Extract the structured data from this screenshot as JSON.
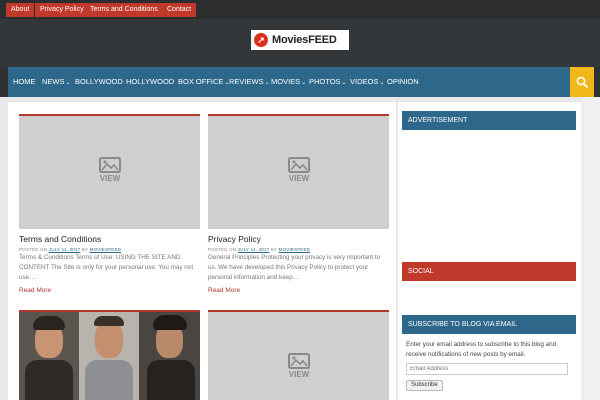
{
  "topbar": {
    "links": [
      "About",
      "Privacy Policy",
      "Terms and Conditions",
      "Contact"
    ]
  },
  "header": {
    "logo_text": "MoviesFEED",
    "logo_color": "#d9301e"
  },
  "nav": {
    "items": [
      {
        "label": "HOME",
        "dropdown": false
      },
      {
        "label": "NEWS",
        "dropdown": true
      },
      {
        "label": "BOLLYWOOD",
        "dropdown": false
      },
      {
        "label": "HOLLYWOOD",
        "dropdown": false
      },
      {
        "label": "BOX OFFICE",
        "dropdown": true
      },
      {
        "label": "REVIEWS",
        "dropdown": true
      },
      {
        "label": "MOVIES",
        "dropdown": true
      },
      {
        "label": "PHOTOS",
        "dropdown": true
      },
      {
        "label": "VIDEOS",
        "dropdown": true
      },
      {
        "label": "OPINION",
        "dropdown": false
      }
    ],
    "caret": "⌄",
    "search_icon": "search-icon",
    "background": "#2d6789",
    "search_color": "#f0b71a"
  },
  "posts": [
    {
      "placeholder": "VIEW",
      "title": "Terms and Conditions",
      "meta_prefix": "POSTED ON",
      "date": "JULY 11, 2017",
      "meta_by": "BY",
      "author": "MOVIESFEED",
      "excerpt": "Terms & Conditions Terms of Use: USING THE SITE AND CONTENT The Site is only for your personal use. You may not use…",
      "read_more": "Read More"
    },
    {
      "placeholder": "VIEW",
      "title": "Privacy Policy",
      "meta_prefix": "POSTED ON",
      "date": "JULY 11, 2017",
      "meta_by": "BY",
      "author": "MOVIESFEED",
      "excerpt": "General Principles Protecting your privacy is very important to us. We have developed this Privacy Policy to protect your personal information and keep…",
      "read_more": "Read More"
    },
    {
      "placeholder": "VIEW"
    }
  ],
  "sidebar": {
    "advertisement_title": "ADVERTISEMENT",
    "social_title": "SOCIAL",
    "subscribe_title": "SUBSCRIBE TO BLOG VIA EMAIL",
    "subscribe_text": "Enter your email address to subscribe to this blog and receive notifications of new posts by email.",
    "email_placeholder": "Email Address",
    "subscribe_button": "Subscribe",
    "colors": {
      "advertisement": "#2d6789",
      "social": "#c0392b",
      "subscribe": "#2d6789"
    }
  }
}
